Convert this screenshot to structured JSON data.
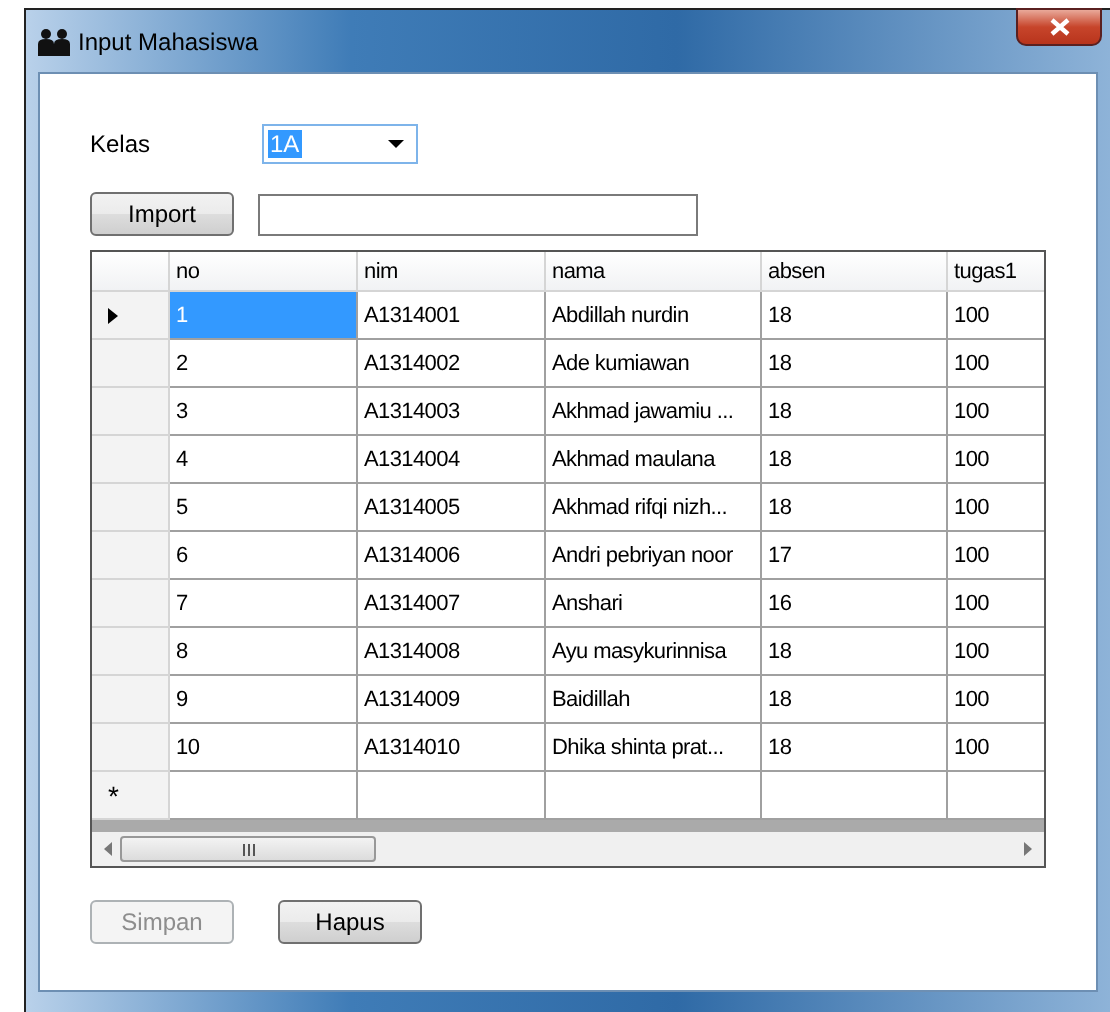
{
  "window": {
    "title": "Input Mahasiswa"
  },
  "kelas": {
    "label": "Kelas",
    "value": "1A",
    "value_selected": true
  },
  "import": {
    "button": "Import"
  },
  "table": {
    "columns": [
      "no",
      "nim",
      "nama",
      "absen",
      "tugas1"
    ],
    "rows": [
      {
        "current": true,
        "cells": [
          "1",
          "A1314001",
          "Abdillah nurdin",
          "18",
          "100"
        ]
      },
      {
        "current": false,
        "cells": [
          "2",
          "A1314002",
          "Ade kumiawan",
          "18",
          "100"
        ]
      },
      {
        "current": false,
        "cells": [
          "3",
          "A1314003",
          "Akhmad jawamiu ...",
          "18",
          "100"
        ]
      },
      {
        "current": false,
        "cells": [
          "4",
          "A1314004",
          "Akhmad maulana",
          "18",
          "100"
        ]
      },
      {
        "current": false,
        "cells": [
          "5",
          "A1314005",
          "Akhmad rifqi nizh...",
          "18",
          "100"
        ]
      },
      {
        "current": false,
        "cells": [
          "6",
          "A1314006",
          "Andri pebriyan noor",
          "17",
          "100"
        ]
      },
      {
        "current": false,
        "cells": [
          "7",
          "A1314007",
          "Anshari",
          "16",
          "100"
        ]
      },
      {
        "current": false,
        "cells": [
          "8",
          "A1314008",
          "Ayu masykurinnisa",
          "18",
          "100"
        ]
      },
      {
        "current": false,
        "cells": [
          "9",
          "A1314009",
          "Baidillah",
          "18",
          "100"
        ]
      },
      {
        "current": false,
        "cells": [
          "10",
          "A1314010",
          "Dhika shinta prat...",
          "18",
          "100"
        ]
      }
    ],
    "new_row_marker": "*"
  },
  "buttons": [
    {
      "label": "Simpan",
      "disabled": true
    },
    {
      "label": "Hapus",
      "disabled": false
    }
  ]
}
